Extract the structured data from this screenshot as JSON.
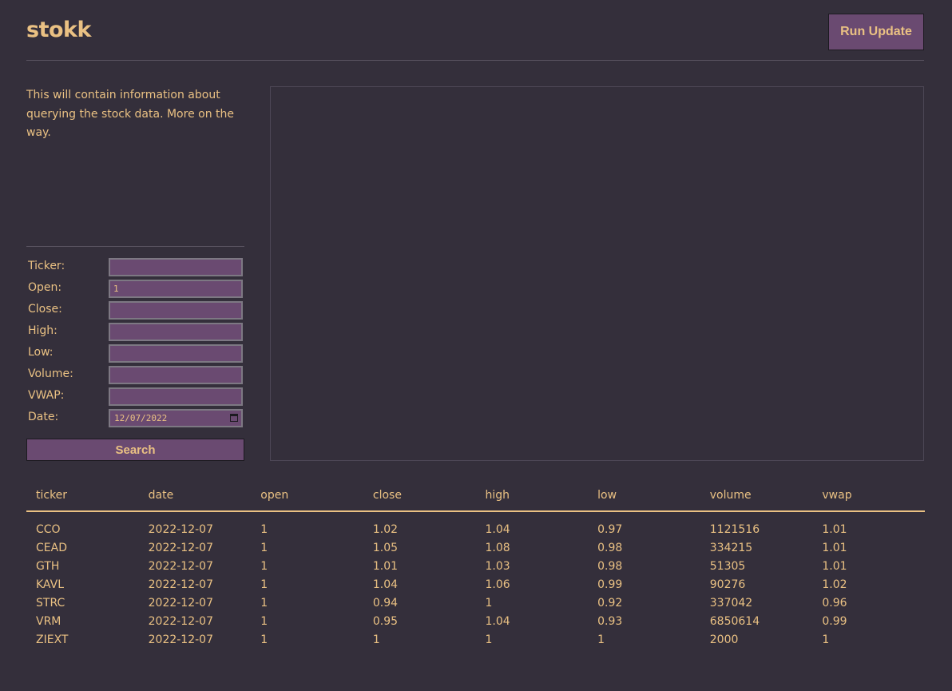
{
  "header": {
    "logo": "stokk",
    "run_update_label": "Run Update"
  },
  "info_text": "This will contain information about querying the stock data. More on the way.",
  "form": {
    "fields": [
      {
        "label": "Ticker:",
        "value": ""
      },
      {
        "label": "Open:",
        "value": "1"
      },
      {
        "label": "Close:",
        "value": ""
      },
      {
        "label": "High:",
        "value": ""
      },
      {
        "label": "Low:",
        "value": ""
      },
      {
        "label": "Volume:",
        "value": ""
      },
      {
        "label": "VWAP:",
        "value": ""
      },
      {
        "label": "Date:",
        "value": "12/07/2022"
      }
    ],
    "search_label": "Search"
  },
  "table": {
    "columns": [
      "ticker",
      "date",
      "open",
      "close",
      "high",
      "low",
      "volume",
      "vwap"
    ],
    "rows": [
      [
        "CCO",
        "2022-12-07",
        "1",
        "1.02",
        "1.04",
        "0.97",
        "1121516",
        "1.01"
      ],
      [
        "CEAD",
        "2022-12-07",
        "1",
        "1.05",
        "1.08",
        "0.98",
        "334215",
        "1.01"
      ],
      [
        "GTH",
        "2022-12-07",
        "1",
        "1.01",
        "1.03",
        "0.98",
        "51305",
        "1.01"
      ],
      [
        "KAVL",
        "2022-12-07",
        "1",
        "1.04",
        "1.06",
        "0.99",
        "90276",
        "1.02"
      ],
      [
        "STRC",
        "2022-12-07",
        "1",
        "0.94",
        "1",
        "0.92",
        "337042",
        "0.96"
      ],
      [
        "VRM",
        "2022-12-07",
        "1",
        "0.95",
        "1.04",
        "0.93",
        "6850614",
        "0.99"
      ],
      [
        "ZIEXT",
        "2022-12-07",
        "1",
        "1",
        "1",
        "1",
        "2000",
        "1"
      ]
    ]
  },
  "colors": {
    "background": "#342f3b",
    "text": "#eac183",
    "accent": "#6a4a71"
  }
}
